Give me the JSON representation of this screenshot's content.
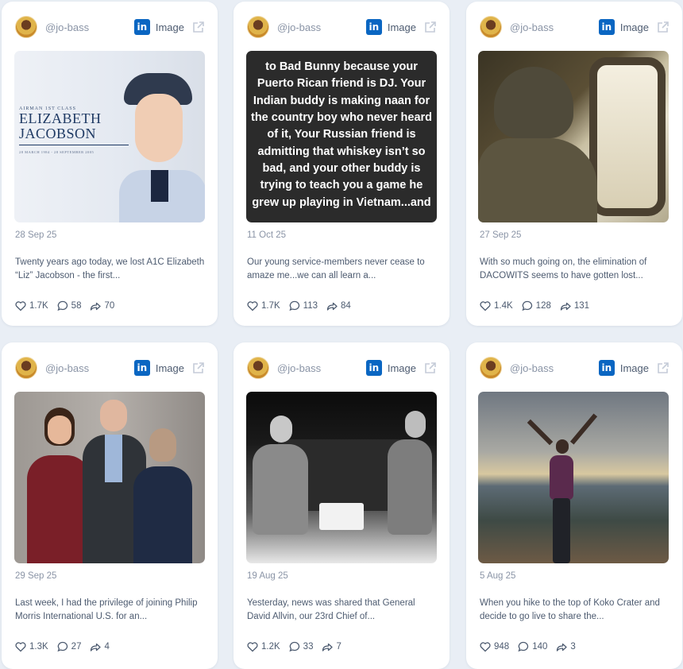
{
  "cards": [
    {
      "handle": "@jo-bass",
      "type": "Image",
      "date": "28 Sep 25",
      "caption": "Twenty years ago today, we lost A1C Elizabeth “Liz” Jacobson - the first...",
      "likes": "1.7K",
      "comments": "58",
      "shares": "70",
      "overlay": {
        "rank": "AIRMAN 1ST CLASS",
        "first": "ELIZABETH",
        "last": "JACOBSON",
        "dates": "28 MARCH 1984 - 28 SEPTEMBER 2005"
      }
    },
    {
      "handle": "@jo-bass",
      "type": "Image",
      "date": "11 Oct 25",
      "caption": "Our young service-members never cease to amaze me...we can all learn a...",
      "likes": "1.7K",
      "comments": "113",
      "shares": "84",
      "post_text": "to Bad Bunny because your Puerto Rican friend is DJ. Your Indian buddy is making naan for the country boy who never heard of it, Your Russian friend is admitting that whiskey isn’t so bad, and your other buddy is trying to teach you a game he grew up playing in Vietnam...and"
    },
    {
      "handle": "@jo-bass",
      "type": "Image",
      "date": "27 Sep 25",
      "caption": "With so much going on, the elimination of DACOWITS seems to have gotten lost...",
      "likes": "1.4K",
      "comments": "128",
      "shares": "131"
    },
    {
      "handle": "@jo-bass",
      "type": "Image",
      "date": "29 Sep 25",
      "caption": "Last week, I had the privilege of joining Philip Morris International U.S. for an...",
      "likes": "1.3K",
      "comments": "27",
      "shares": "4"
    },
    {
      "handle": "@jo-bass",
      "type": "Image",
      "date": "19 Aug 25",
      "caption": "Yesterday, news was shared that General David Allvin, our 23rd Chief of...",
      "likes": "1.2K",
      "comments": "33",
      "shares": "7"
    },
    {
      "handle": "@jo-bass",
      "type": "Image",
      "date": "5 Aug 25",
      "caption": "When you hike to the top of Koko Crater and decide to go live to share the...",
      "likes": "948",
      "comments": "140",
      "shares": "3"
    }
  ],
  "icons": {
    "network": "linkedin-icon",
    "open": "external-link-icon",
    "likes": "heart-icon",
    "comments": "comment-icon",
    "shares": "share-icon"
  },
  "colors": {
    "linkedin": "#0a66c2",
    "background": "#e9eef5",
    "card": "#ffffff",
    "muted_text": "#8a94a6"
  }
}
